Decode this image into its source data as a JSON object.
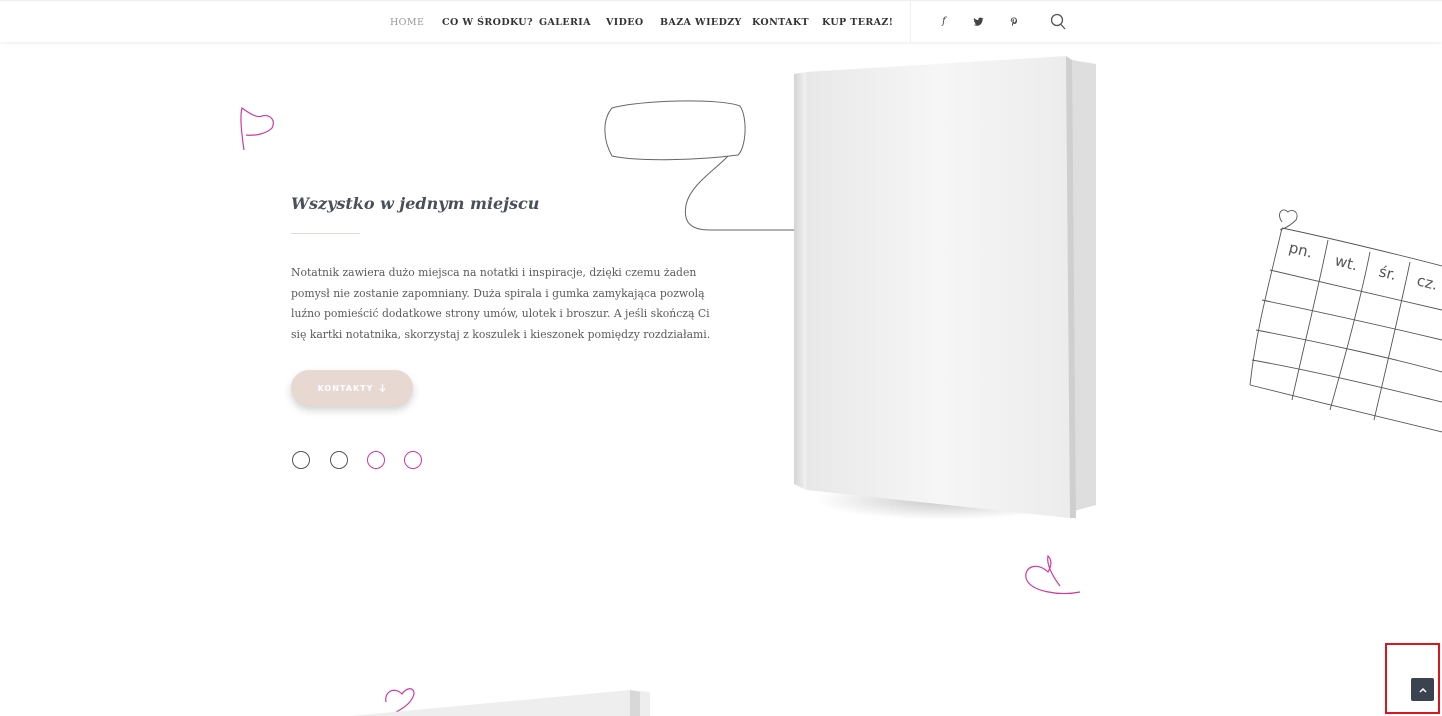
{
  "nav": {
    "items": [
      {
        "label": "HOME",
        "active": true
      },
      {
        "label": "CO W ŚRODKU?"
      },
      {
        "label": "GALERIA"
      },
      {
        "label": "VIDEO"
      },
      {
        "label": "BAZA WIEDZY"
      },
      {
        "label": "KONTAKT"
      },
      {
        "label": "KUP TERAZ!"
      }
    ],
    "social": [
      {
        "icon": "facebook-icon",
        "glyph": "f"
      },
      {
        "icon": "twitter-icon",
        "glyph": "🐦"
      },
      {
        "icon": "pinterest-icon",
        "glyph": "℗"
      }
    ]
  },
  "hero": {
    "heading": "Wszystko w jednym miejscu",
    "body": "Notatnik zawiera dużo miejsca na notatki i inspiracje, dzięki czemu żaden pomysł nie zostanie zapomniany. Duża spirala i gumka zamykająca pozwolą luźno pomieścić dodatkowe strony umów, ulotek i broszur. A jeśli skończą Ci się kartki notatnika, skorzystaj z koszulek i kieszonek pomiędzy rozdziałami.",
    "button_label": "KONTAKTY",
    "button_icon": "arrow-down-icon",
    "slider_dots": 4,
    "active_dot": 3
  },
  "calendar_sketch": {
    "days": [
      "pn.",
      "wt.",
      "śr.",
      "cz."
    ]
  },
  "colors": {
    "accent_pink": "#d0399e",
    "button_bg": "#e8d8d2",
    "scroll_top_bg": "#3b4350",
    "highlight_frame": "#e0141c"
  }
}
